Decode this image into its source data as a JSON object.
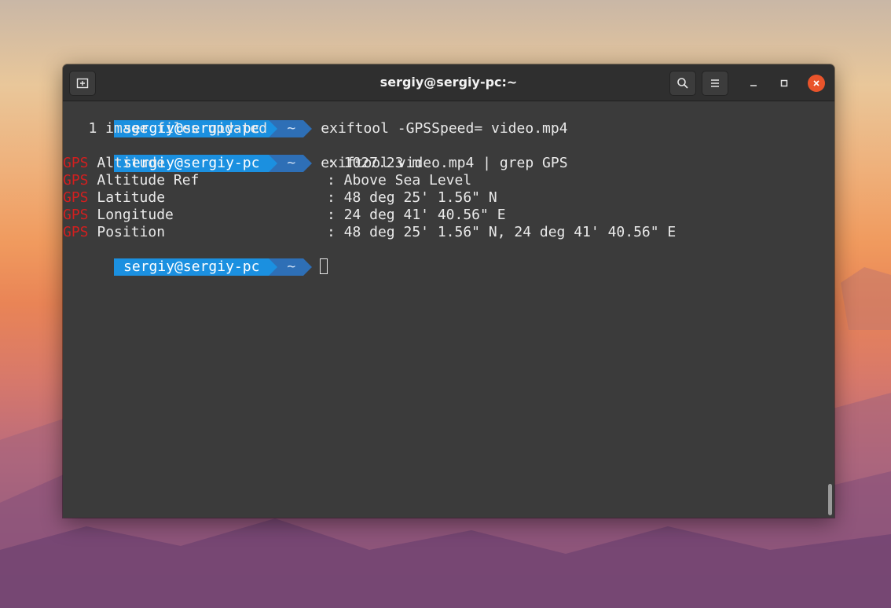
{
  "window": {
    "title": "sergiy@sergiy-pc:~",
    "icons": {
      "new_tab": "new-tab-icon",
      "search": "search-icon",
      "menu": "hamburger-menu-icon",
      "minimize": "minimize-icon",
      "maximize": "maximize-icon",
      "close": "close-icon"
    },
    "colors": {
      "close": "#e9542b",
      "prompt_user_bg": "#1b90e0",
      "prompt_dir_bg": "#2e6fb6",
      "gps_highlight": "#d21f1f"
    }
  },
  "terminal": {
    "prompt": {
      "user": "sergiy@sergiy-pc",
      "dir": "~"
    },
    "commands": [
      "exiftool -GPSSpeed= video.mp4",
      "exiftool video.mp4 | grep GPS"
    ],
    "update_output": "   1 image files updated",
    "gps_label": "GPS",
    "rows": [
      {
        "field": " Altitude                   ",
        "value": ": 1027.23 m"
      },
      {
        "field": " Altitude Ref               ",
        "value": ": Above Sea Level"
      },
      {
        "field": " Latitude                   ",
        "value": ": 48 deg 25' 1.56\" N"
      },
      {
        "field": " Longitude                  ",
        "value": ": 24 deg 41' 40.56\" E"
      },
      {
        "field": " Position                   ",
        "value": ": 48 deg 25' 1.56\" N, 24 deg 41' 40.56\" E"
      }
    ]
  }
}
